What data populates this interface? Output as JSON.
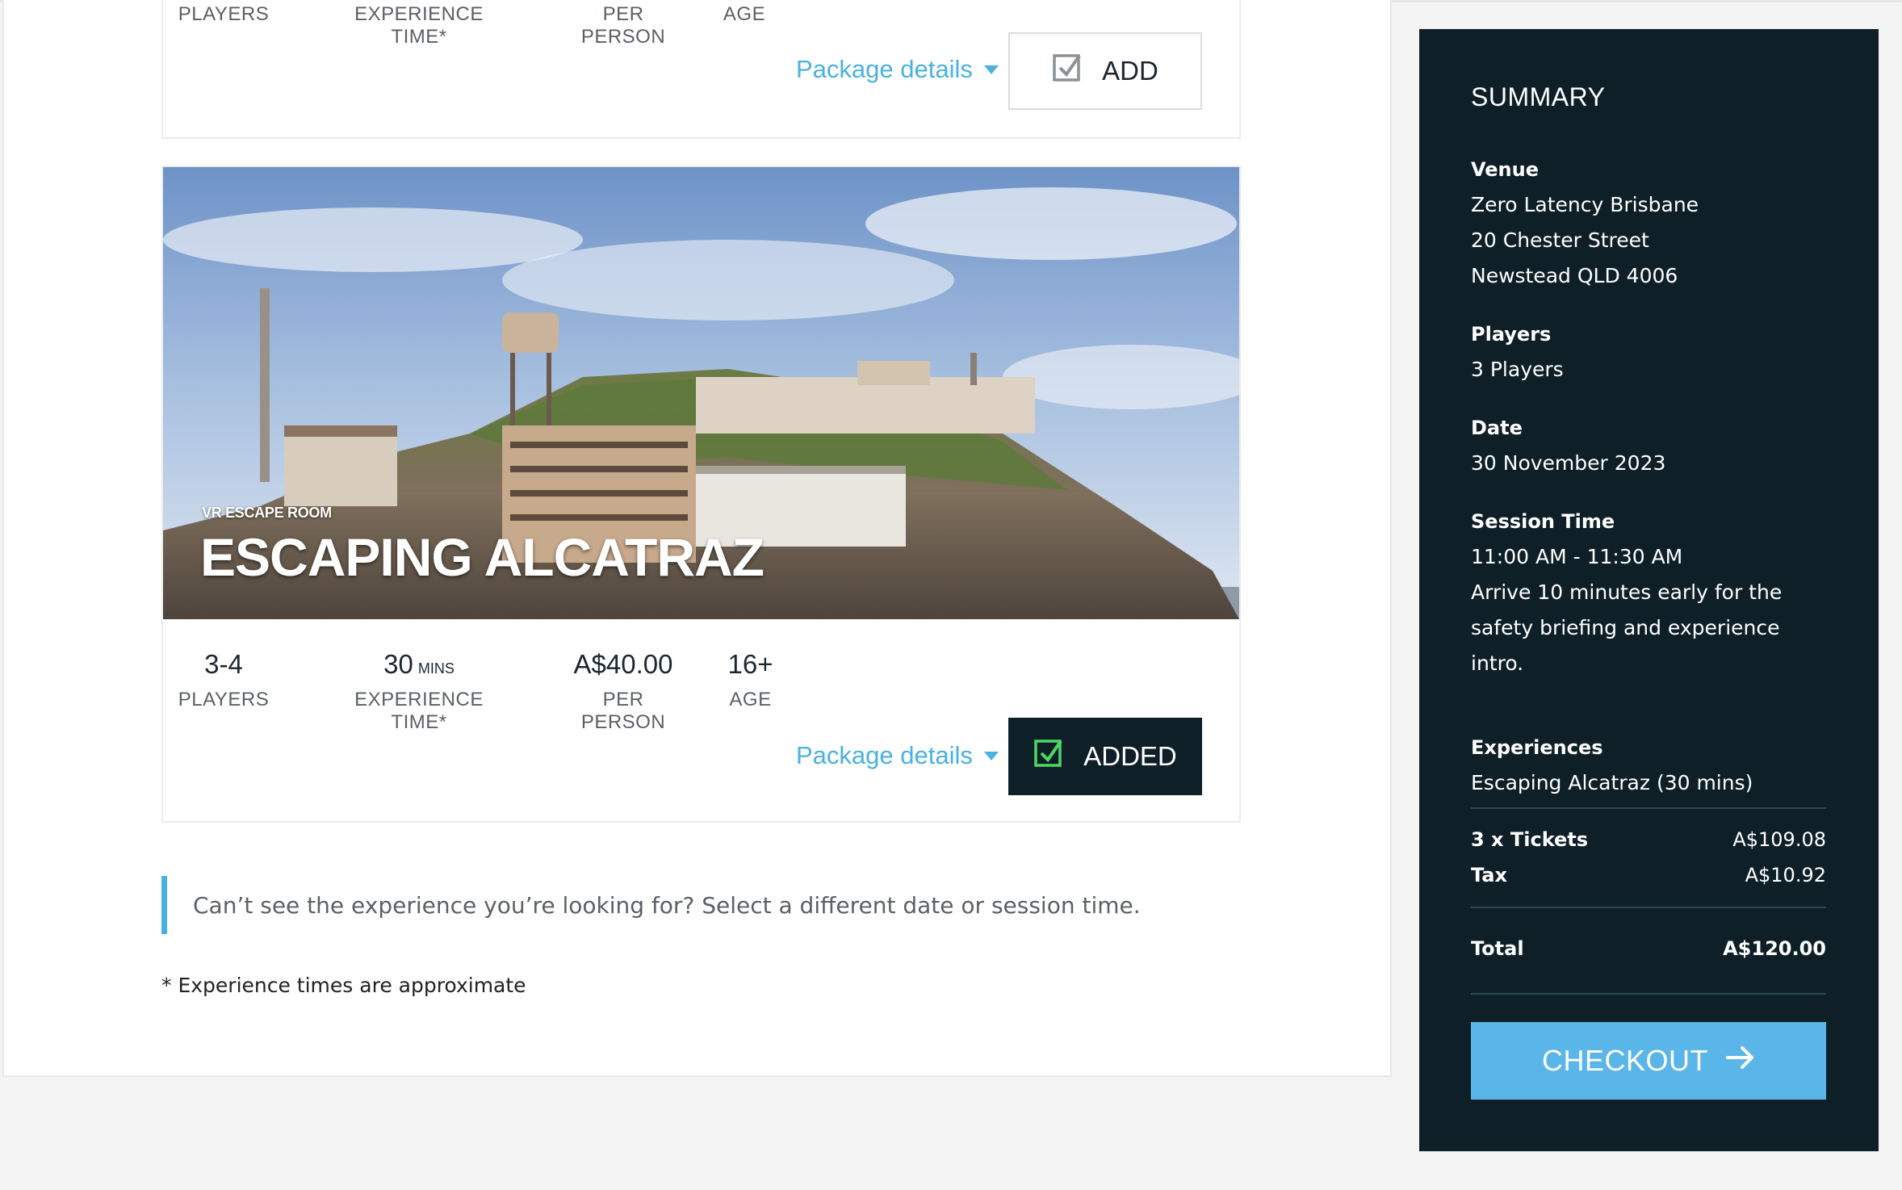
{
  "experience_top": {
    "labels": {
      "players": "PLAYERS",
      "time": "EXPERIENCE TIME*",
      "price": "PER PERSON",
      "age": "AGE"
    },
    "package_details": "Package details",
    "button_label": "ADD"
  },
  "experience_alcatraz": {
    "tag": "VR ESCAPE ROOM",
    "title": "ESCAPING ALCATRAZ",
    "players": "3-4",
    "time": "30",
    "time_unit": "MINS",
    "price": "A$40.00",
    "age": "16+",
    "labels": {
      "players": "PLAYERS",
      "time": "EXPERIENCE TIME*",
      "price": "PER PERSON",
      "age": "AGE"
    },
    "package_details": "Package details",
    "button_label": "ADDED"
  },
  "notice": "Can’t see the experience you’re looking for? Select a different date or session time.",
  "footnote": "* Experience times are approximate",
  "summary": {
    "title": "SUMMARY",
    "venue_label": "Venue",
    "venue_name": "Zero Latency Brisbane",
    "venue_street": "20 Chester Street",
    "venue_city": "Newstead QLD 4006",
    "players_label": "Players",
    "players_value": "3 Players",
    "date_label": "Date",
    "date_value": "30 November 2023",
    "session_label": "Session Time",
    "session_value": "11:00 AM - 11:30 AM",
    "session_note_1": "Arrive 10 minutes early for the",
    "session_note_2": "safety briefing and experience",
    "session_note_3": "intro.",
    "experiences_label": "Experiences",
    "experiences_value": "Escaping Alcatraz (30 mins)",
    "tickets_label": "3 x Tickets",
    "tickets_value": "A$109.08",
    "tax_label": "Tax",
    "tax_value": "A$10.92",
    "total_label": "Total",
    "total_value": "A$120.00",
    "checkout_label": "CHECKOUT"
  },
  "colors": {
    "accent": "#4ab1e2",
    "dark": "#0f1f27",
    "checkout": "#5ab6e8",
    "check_green": "#4cd964"
  },
  "icons": {
    "add": "checkbox-icon",
    "added": "checkbox-checked-icon",
    "checkout": "arrow-right-icon",
    "dropdown": "caret-down-icon"
  }
}
